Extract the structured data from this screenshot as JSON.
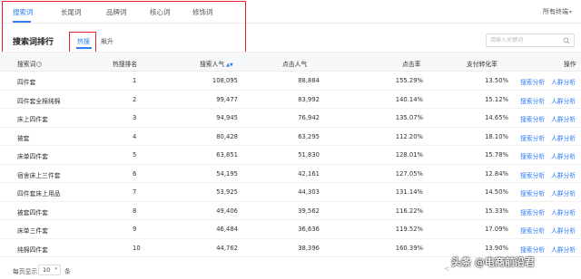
{
  "tabs": [
    {
      "label": "搜索词",
      "active": true
    },
    {
      "label": "长尾词",
      "active": false
    },
    {
      "label": "品牌词",
      "active": false
    },
    {
      "label": "核心词",
      "active": false
    },
    {
      "label": "修饰词",
      "active": false
    }
  ],
  "terminal_filter": "所有终端",
  "section_title": "搜索词排行",
  "subtabs": {
    "hot": "热搜",
    "rise": "飙升"
  },
  "search": {
    "placeholder": "请输入关键词"
  },
  "table": {
    "headers": {
      "keyword": "搜索词",
      "rank": "热搜排名",
      "search_popularity": "搜索人气",
      "click_popularity": "点击人气",
      "click_rate": "点击率",
      "conversion_rate": "支付转化率",
      "actions": "操作"
    },
    "rows": [
      {
        "keyword": "四件套",
        "rank": "1",
        "search_popularity": "108,095",
        "click_popularity": "88,884",
        "click_rate": "155.29%",
        "conversion_rate": "13.50%"
      },
      {
        "keyword": "四件套全棉纯棉",
        "rank": "2",
        "search_popularity": "99,477",
        "click_popularity": "83,992",
        "click_rate": "140.14%",
        "conversion_rate": "15.12%"
      },
      {
        "keyword": "床上四件套",
        "rank": "3",
        "search_popularity": "94,945",
        "click_popularity": "76,942",
        "click_rate": "135.07%",
        "conversion_rate": "14.65%"
      },
      {
        "keyword": "被套",
        "rank": "4",
        "search_popularity": "80,428",
        "click_popularity": "63,295",
        "click_rate": "112.20%",
        "conversion_rate": "18.10%"
      },
      {
        "keyword": "床单四件套",
        "rank": "5",
        "search_popularity": "63,851",
        "click_popularity": "51,830",
        "click_rate": "128.01%",
        "conversion_rate": "15.78%"
      },
      {
        "keyword": "宿舍床上三件套",
        "rank": "6",
        "search_popularity": "54,195",
        "click_popularity": "42,161",
        "click_rate": "127.05%",
        "conversion_rate": "12.84%"
      },
      {
        "keyword": "四件套床上用品",
        "rank": "7",
        "search_popularity": "53,925",
        "click_popularity": "44,303",
        "click_rate": "131.14%",
        "conversion_rate": "14.50%"
      },
      {
        "keyword": "被套四件套",
        "rank": "8",
        "search_popularity": "49,406",
        "click_popularity": "39,562",
        "click_rate": "116.22%",
        "conversion_rate": "15.33%"
      },
      {
        "keyword": "床单三件套",
        "rank": "9",
        "search_popularity": "46,484",
        "click_popularity": "36,636",
        "click_rate": "119.52%",
        "conversion_rate": "17.09%"
      },
      {
        "keyword": "纯棉四件套",
        "rank": "10",
        "search_popularity": "44,762",
        "click_popularity": "38,396",
        "click_rate": "160.39%",
        "conversion_rate": "13.90%"
      }
    ],
    "action_labels": {
      "search_analysis": "搜索分析",
      "crowd_analysis": "人群分析"
    }
  },
  "footer": {
    "page_size_label": "每页显示",
    "page_size_value": "10",
    "page_size_unit": "条",
    "prev_symbol": "<"
  },
  "watermark": "头条 @电商前沿君",
  "colors": {
    "accent": "#2f7cf6",
    "highlight_box": "#e8202a",
    "header_bg": "#f7f8fa"
  }
}
